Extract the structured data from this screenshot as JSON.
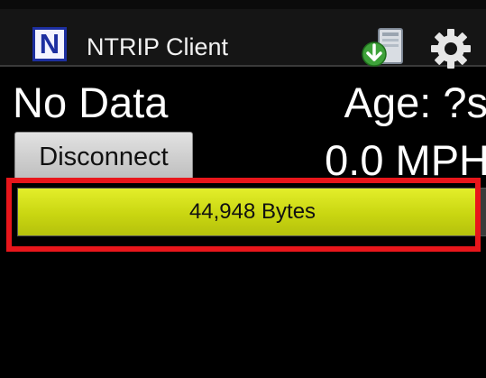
{
  "app": {
    "title": "NTRIP Client",
    "logo_letter": "N",
    "icons": [
      "download-icon",
      "gear-icon"
    ]
  },
  "status": {
    "text": "No Data",
    "age": "Age: ?s",
    "speed": "0.0 MPH"
  },
  "controls": {
    "disconnect_label": "Disconnect"
  },
  "bytes_bar": {
    "label": "44,948 Bytes",
    "fill_fraction": 0.985
  },
  "colors": {
    "background": "#000000",
    "bar_fill": "#d4df1a",
    "highlight": "#e8161b",
    "logo_blue": "#1d2fa0"
  }
}
